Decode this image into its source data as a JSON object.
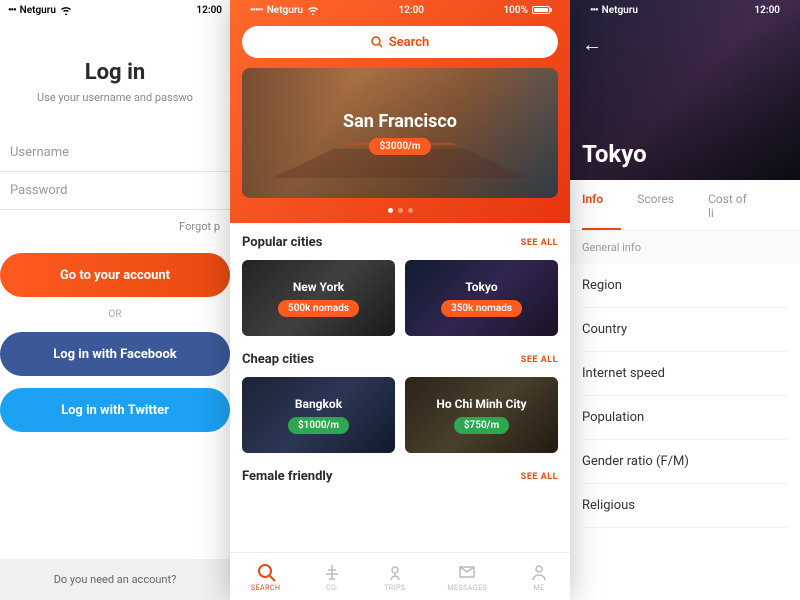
{
  "status": {
    "carrier": "Netguru",
    "time": "12:00",
    "battery": "100%"
  },
  "screen1": {
    "title": "Log in",
    "subtitle": "Use your username and passwo",
    "fields": {
      "username": "Username",
      "password": "Password"
    },
    "forgot": "Forgot p",
    "buttons": {
      "account": "Go to your account",
      "or": "OR",
      "facebook": "Log in with Facebook",
      "twitter": "Log in with Twitter"
    },
    "signup": "Do you need an account?"
  },
  "screen2": {
    "search": "Search",
    "hero": {
      "city": "San Francisco",
      "price": "$3000/m"
    },
    "sections": [
      {
        "title": "Popular cities",
        "see": "SEE ALL",
        "cities": [
          {
            "name": "New York",
            "badge": "500k nomads",
            "badgeColor": "orange",
            "bg": "ny"
          },
          {
            "name": "Tokyo",
            "badge": "350k nomads",
            "badgeColor": "orange",
            "bg": "tk"
          }
        ]
      },
      {
        "title": "Cheap cities",
        "see": "SEE ALL",
        "cities": [
          {
            "name": "Bangkok",
            "badge": "$1000/m",
            "badgeColor": "green",
            "bg": "bk"
          },
          {
            "name": "Ho Chi Minh City",
            "badge": "$750/m",
            "badgeColor": "green",
            "bg": "hc"
          }
        ]
      },
      {
        "title": "Female friendly",
        "see": "SEE ALL",
        "cities": []
      }
    ],
    "tabs": [
      {
        "label": "SEARCH",
        "icon": "search",
        "active": true
      },
      {
        "label": "CO-",
        "icon": "cowork",
        "active": false
      },
      {
        "label": "TRIPS",
        "icon": "trips",
        "active": false
      },
      {
        "label": "MESSAGES",
        "icon": "messages",
        "active": false
      },
      {
        "label": "ME",
        "icon": "me",
        "active": false
      }
    ]
  },
  "screen3": {
    "city": "Tokyo",
    "tabs": [
      {
        "label": "Info",
        "active": true
      },
      {
        "label": "Scores",
        "active": false
      },
      {
        "label": "Cost of li",
        "active": false
      }
    ],
    "subhead": "General info",
    "items": [
      "Region",
      "Country",
      "Internet speed",
      "Population",
      "Gender ratio (F/M)",
      "Religious"
    ]
  }
}
